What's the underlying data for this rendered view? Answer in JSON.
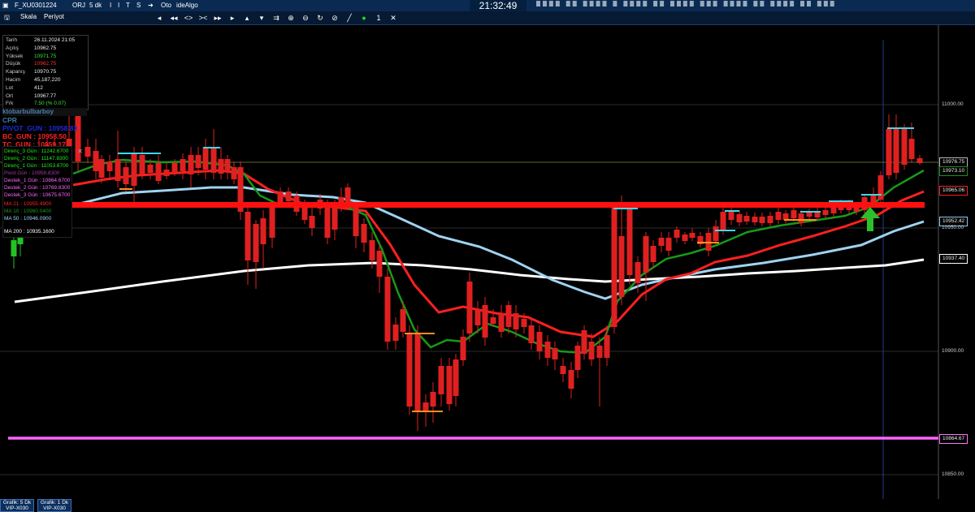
{
  "window": {
    "symbol": "F_XU0301224",
    "period_code": "ORJ",
    "interval": "5 dk",
    "toolbar_buttons": [
      "I",
      "I",
      "T",
      "S"
    ],
    "mode_oto": "Oto",
    "mode_algo": "ideAlgo",
    "clock": "21:32:49",
    "colors": {
      "background": "#000000",
      "up": "#22c322",
      "down": "#e02020",
      "accent": "#0a2a52"
    }
  },
  "menu": {
    "skala": "Skala",
    "periyot": "Periyot"
  },
  "drawing_tools": {
    "line_count": "1"
  },
  "info_panel": [
    {
      "label": "Tarih",
      "value": "26.11.2024 21:05",
      "color": "#eeeeee"
    },
    {
      "label": "Açılış",
      "value": "10962.75",
      "color": "#eeeeee"
    },
    {
      "label": "Yüksek",
      "value": "10971.75",
      "color": "#3fe03f"
    },
    {
      "label": "Düşük",
      "value": "10962.75",
      "color": "#ff3030"
    },
    {
      "label": "Kapanış",
      "value": "10970.75",
      "color": "#eeeeee"
    },
    {
      "label": "Hacim",
      "value": "45,187,220",
      "color": "#eeeeee"
    },
    {
      "label": "Lot",
      "value": "412",
      "color": "#eeeeee"
    },
    {
      "label": "Ort",
      "value": "10967.77",
      "color": "#eeeeee"
    },
    {
      "label": "Frk",
      "value": "7.50 (% 0.07)",
      "color": "#3fe03f"
    }
  ],
  "brand": "ktobarbulbarboy",
  "cpr": {
    "title": "CPR",
    "pivot": "PIVOT_GUN : 10958.83",
    "bc": "BC_GUN : 10958.50",
    "tc": "TC_GUN : 10959.17"
  },
  "levels": [
    {
      "text": "Direnç_3 Gün : 11242.6700",
      "color": "#22ee22"
    },
    {
      "text": "Direnç_2 Gün : 11147.8300",
      "color": "#22ee22"
    },
    {
      "text": "Direnç_1 Gün : 11053.6700",
      "color": "#22ee22"
    },
    {
      "text": "Pivot Gün : 10958.8300",
      "color": "#a03aa0"
    },
    {
      "text": "Destek_1 Gün : 10864.6700",
      "color": "#ff66ff"
    },
    {
      "text": "Destek_2 Gün : 10769.8300",
      "color": "#ff66ff"
    },
    {
      "text": "Destek_3 Gün : 10675.6700",
      "color": "#ff66ff"
    },
    {
      "text": "MA 21 : 10955.4900",
      "color": "#ff2020"
    },
    {
      "text": "MA 10 : 10960.0400",
      "color": "#179a17"
    },
    {
      "text": "MA 50 : 10946.0900",
      "color": "#9fd3f0"
    },
    {
      "text": "MA 200 : 10935.1600",
      "color": "#ffffff"
    }
  ],
  "price_axis": {
    "labels": [
      "11000.00",
      "10950.00",
      "10900.00",
      "10850.00"
    ],
    "tags": [
      {
        "value": "10976.75",
        "color": "#bbbbbb"
      },
      {
        "value": "10973.10",
        "color": "#1e8e1e"
      },
      {
        "value": "10965.06",
        "color": "#ff2020"
      },
      {
        "value": "10952.42",
        "color": "#8fc8ea"
      },
      {
        "value": "10937.40",
        "color": "#ffffff"
      },
      {
        "value": "10864.67",
        "color": "#ff77ff"
      }
    ]
  },
  "bottom_tabs": [
    {
      "line1": "Grafik: 5 Dk",
      "line2": "VIP-X030"
    },
    {
      "line1": "Grafik: 1 Dk",
      "line2": "VIP-X030"
    }
  ]
}
